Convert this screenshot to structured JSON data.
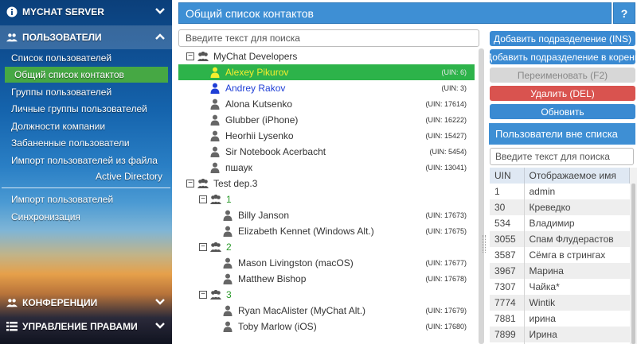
{
  "sidebar": {
    "server_title": "MYCHAT SERVER",
    "users_section": "ПОЛЬЗОВАТЕЛИ",
    "items": [
      {
        "label": "Список пользователей",
        "active": false
      },
      {
        "label": "Общий список контактов",
        "active": true
      },
      {
        "label": "Группы пользователей",
        "active": false
      },
      {
        "label": "Личные группы пользователей",
        "active": false
      },
      {
        "label": "Должности компании",
        "active": false
      },
      {
        "label": "Забаненные пользователи",
        "active": false
      },
      {
        "label": "Импорт пользователей из файла",
        "active": false
      }
    ],
    "ad_title": "Active Directory",
    "ad_items": [
      {
        "label": "Импорт пользователей"
      },
      {
        "label": "Синхронизация"
      }
    ],
    "conferences_section": "КОНФЕРЕНЦИИ",
    "rights_section": "УПРАВЛЕНИЕ ПРАВАМИ"
  },
  "main": {
    "title": "Общий список контактов",
    "help": "?",
    "search_placeholder": "Введите текст для поиска",
    "tree": [
      {
        "type": "group",
        "level": 0,
        "name": "MyChat Developers"
      },
      {
        "type": "user",
        "level": 1,
        "name": "Alexey Pikurov",
        "uin": "(UIN: 6)",
        "selected": true,
        "color": "normal"
      },
      {
        "type": "user",
        "level": 1,
        "name": "Andrey Rakov",
        "uin": "(UIN: 3)",
        "selected": false,
        "color": "blue"
      },
      {
        "type": "user",
        "level": 1,
        "name": "Alona Kutsenko",
        "uin": "(UIN: 17614)",
        "selected": false,
        "color": "normal"
      },
      {
        "type": "user",
        "level": 1,
        "name": "Glubber (iPhone)",
        "uin": "(UIN: 16222)",
        "selected": false,
        "color": "normal"
      },
      {
        "type": "user",
        "level": 1,
        "name": "Heorhii Lysenko",
        "uin": "(UIN: 15427)",
        "selected": false,
        "color": "normal"
      },
      {
        "type": "user",
        "level": 1,
        "name": "Sir Notebook Acerbacht",
        "uin": "(UIN: 5454)",
        "selected": false,
        "color": "normal"
      },
      {
        "type": "user",
        "level": 1,
        "name": "пшаук",
        "uin": "(UIN: 13041)",
        "selected": false,
        "color": "normal"
      },
      {
        "type": "group",
        "level": 0,
        "name": "Test dep.3"
      },
      {
        "type": "group",
        "level": 1,
        "name": "1",
        "color": "green"
      },
      {
        "type": "user",
        "level": 2,
        "name": "Billy Janson",
        "uin": "(UIN: 17673)",
        "selected": false,
        "color": "normal"
      },
      {
        "type": "user",
        "level": 2,
        "name": "Elizabeth Kennet (Windows Alt.)",
        "uin": "(UIN: 17675)",
        "selected": false,
        "color": "normal"
      },
      {
        "type": "group",
        "level": 1,
        "name": "2",
        "color": "green"
      },
      {
        "type": "user",
        "level": 2,
        "name": "Mason Livingston (macOS)",
        "uin": "(UIN: 17677)",
        "selected": false,
        "color": "normal"
      },
      {
        "type": "user",
        "level": 2,
        "name": "Matthew Bishop",
        "uin": "(UIN: 17678)",
        "selected": false,
        "color": "normal"
      },
      {
        "type": "group",
        "level": 1,
        "name": "3",
        "color": "green"
      },
      {
        "type": "user",
        "level": 2,
        "name": "Ryan MacAlister (MyChat Alt.)",
        "uin": "(UIN: 17679)",
        "selected": false,
        "color": "normal"
      },
      {
        "type": "user",
        "level": 2,
        "name": "Toby Marlow (iOS)",
        "uin": "(UIN: 17680)",
        "selected": false,
        "color": "normal"
      }
    ]
  },
  "actions": {
    "add_sub": "Добавить подразделение (INS)",
    "add_root": "Добавить подразделение в корень",
    "rename": "Переименовать (F2)",
    "delete": "Удалить (DEL)",
    "refresh": "Обновить"
  },
  "outside": {
    "title": "Пользователи вне списка",
    "search_placeholder": "Введите текст для поиска",
    "columns": [
      "UIN",
      "Отображаемое имя"
    ],
    "rows": [
      [
        "1",
        "admin"
      ],
      [
        "30",
        "Креведко"
      ],
      [
        "534",
        "Владимир"
      ],
      [
        "3055",
        "Спам Флудерастов"
      ],
      [
        "3587",
        "Сёмга в стрингах"
      ],
      [
        "3967",
        "Марина"
      ],
      [
        "7307",
        "Чайка*"
      ],
      [
        "7774",
        "Wintik"
      ],
      [
        "7881",
        "ирина"
      ],
      [
        "7899",
        "Ирина"
      ],
      [
        "",
        ""
      ]
    ]
  },
  "colors": {
    "accent": "#3e8fd4",
    "selected_row": "#2db34a",
    "selected_text": "#f4ee2e",
    "delete_button": "#d9534f",
    "active_sidebar": "#46a844"
  }
}
